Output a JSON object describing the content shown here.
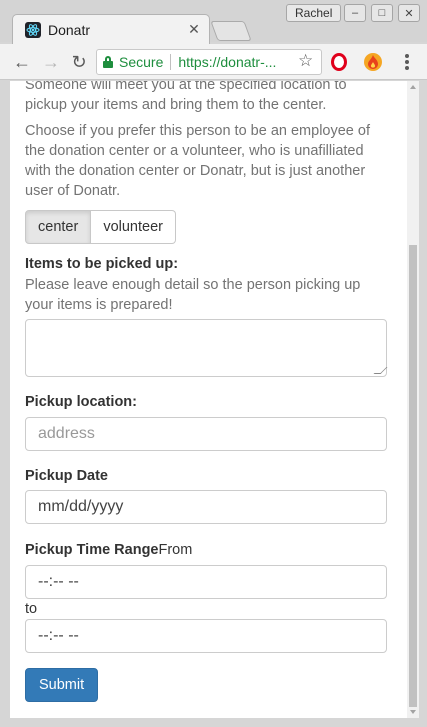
{
  "browser": {
    "tab_title": "Donatr",
    "profile_name": "Rachel",
    "secure_label": "Secure",
    "url": "https://donatr-...",
    "window_buttons": {
      "minimize": "–",
      "maximize": "□",
      "close": "✕"
    },
    "extensions": [
      "opera-icon",
      "flame-icon"
    ]
  },
  "form": {
    "intro_text": "Someone will meet you at the specified location to pickup your items and bring them to the center.",
    "choose_text": "Choose if you prefer this person to be an employee of the donation center or a volunteer, who is unafilliated with the donation center or Donatr, but is just another user of Donatr.",
    "toggle": {
      "center": "center",
      "volunteer": "volunteer",
      "selected": "center"
    },
    "items_label": "Items to be picked up:",
    "items_help": "Please leave enough detail so the person picking up your items is prepared!",
    "location_label": "Pickup location:",
    "location_placeholder": "address",
    "date_label": "Pickup Date",
    "date_value": "mm/dd/yyyy",
    "time_label": "Pickup Time Range",
    "time_from": "From",
    "time_start_value": "--:-- --",
    "time_to": "to",
    "time_end_value": "--:-- --",
    "submit_label": "Submit"
  },
  "colors": {
    "primary": "#337ab7",
    "secure_green": "#1e8e3e",
    "text_muted": "#737373"
  }
}
